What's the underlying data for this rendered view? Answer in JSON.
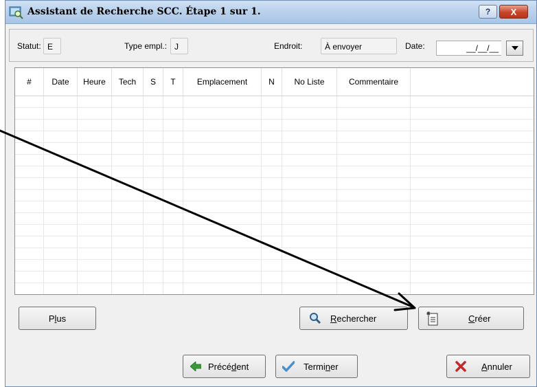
{
  "window": {
    "title": "Assistant de Recherche SCC. Étape 1 sur 1.",
    "help_label": "?",
    "close_label": "X"
  },
  "filters": {
    "statut_label": "Statut:",
    "statut_value": "E",
    "type_label": "Type empl.:",
    "type_value": "J",
    "endroit_label": "Endroit:",
    "endroit_value": "À envoyer",
    "date_label": "Date:",
    "date_value": "__/__/__"
  },
  "grid": {
    "columns": [
      "#",
      "Date",
      "Heure",
      "Tech",
      "S",
      "T",
      "Emplacement",
      "N",
      "No Liste",
      "Commentaire"
    ]
  },
  "buttons": {
    "plus": {
      "pre": "P",
      "u": "l",
      "post": "us"
    },
    "rechercher": {
      "pre": "",
      "u": "R",
      "post": "echercher"
    },
    "creer": {
      "pre": "",
      "u": "C",
      "post": "réer"
    },
    "precedent": {
      "pre": "Précé",
      "u": "d",
      "post": "ent"
    },
    "terminer": {
      "pre": "Termi",
      "u": "n",
      "post": "er"
    },
    "annuler": {
      "pre": "",
      "u": "A",
      "post": "nnuler"
    }
  },
  "icons": {
    "app": "search-assistant-icon",
    "rechercher": "magnifier-icon",
    "creer": "new-document-icon",
    "precedent": "green-left-arrow-icon",
    "terminer": "checkmark-icon",
    "annuler": "red-x-icon"
  },
  "colors": {
    "title_bar": "#b9d1ec",
    "close_button": "#c9452a",
    "window_bg": "#f0f0f0"
  }
}
